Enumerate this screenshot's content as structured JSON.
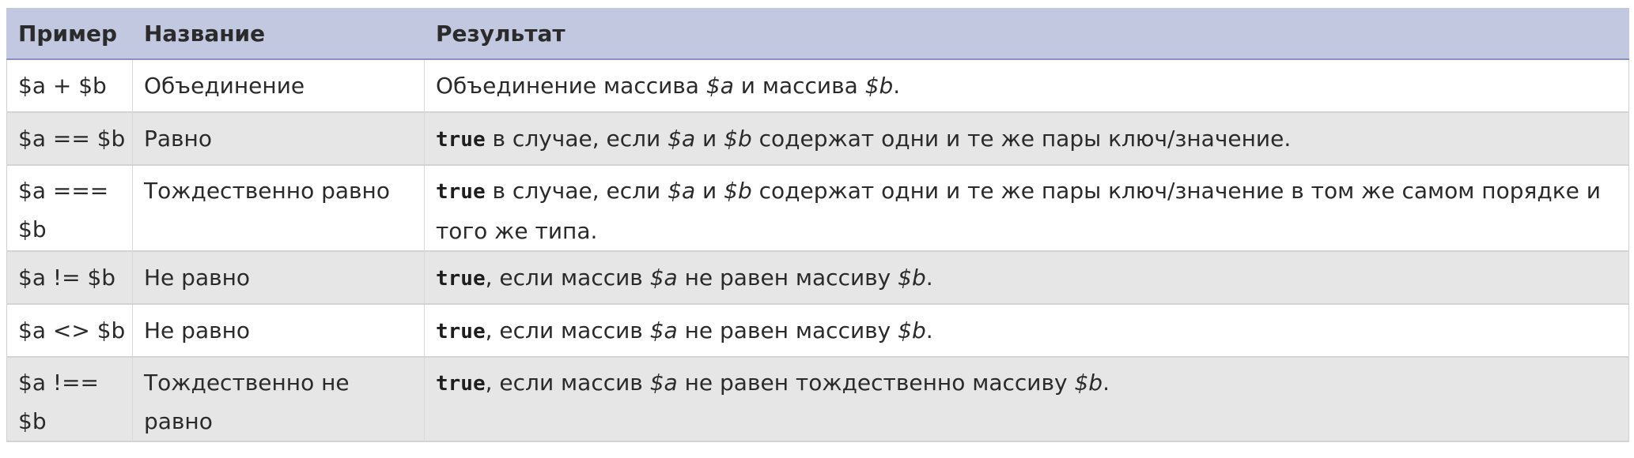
{
  "table": {
    "headers": [
      "Пример",
      "Название",
      "Результат"
    ],
    "rows": [
      {
        "example": "$a + $b",
        "name": "Объединение",
        "result_parts": [
          {
            "text": "Объединение массива ",
            "style": "plain"
          },
          {
            "text": "$a",
            "style": "var"
          },
          {
            "text": " и массива ",
            "style": "plain"
          },
          {
            "text": "$b",
            "style": "var"
          },
          {
            "text": ".",
            "style": "plain"
          }
        ]
      },
      {
        "example": "$a == $b",
        "name": "Равно",
        "result_parts": [
          {
            "text": "true",
            "style": "kw"
          },
          {
            "text": " в случае, если ",
            "style": "plain"
          },
          {
            "text": "$a",
            "style": "var"
          },
          {
            "text": " и ",
            "style": "plain"
          },
          {
            "text": "$b",
            "style": "var"
          },
          {
            "text": " содержат одни и те же пары ключ/значение.",
            "style": "plain"
          }
        ]
      },
      {
        "example": "$a === $b",
        "name": "Тождественно равно",
        "result_parts": [
          {
            "text": "true",
            "style": "kw"
          },
          {
            "text": " в случае, если ",
            "style": "plain"
          },
          {
            "text": "$a",
            "style": "var"
          },
          {
            "text": " и ",
            "style": "plain"
          },
          {
            "text": "$b",
            "style": "var"
          },
          {
            "text": " содержат одни и те же пары ключ/значение в том же самом порядке и того же типа.",
            "style": "plain"
          }
        ]
      },
      {
        "example": "$a != $b",
        "name": "Не равно",
        "result_parts": [
          {
            "text": "true",
            "style": "kw"
          },
          {
            "text": ", если массив ",
            "style": "plain"
          },
          {
            "text": "$a",
            "style": "var"
          },
          {
            "text": " не равен массиву ",
            "style": "plain"
          },
          {
            "text": "$b",
            "style": "var"
          },
          {
            "text": ".",
            "style": "plain"
          }
        ]
      },
      {
        "example": "$a <> $b",
        "name": "Не равно",
        "result_parts": [
          {
            "text": "true",
            "style": "kw"
          },
          {
            "text": ", если массив ",
            "style": "plain"
          },
          {
            "text": "$a",
            "style": "var"
          },
          {
            "text": " не равен массиву ",
            "style": "plain"
          },
          {
            "text": "$b",
            "style": "var"
          },
          {
            "text": ".",
            "style": "plain"
          }
        ]
      },
      {
        "example": "$a !== $b",
        "name": "Тождественно не равно",
        "result_parts": [
          {
            "text": "true",
            "style": "kw"
          },
          {
            "text": ", если массив ",
            "style": "plain"
          },
          {
            "text": "$a",
            "style": "var"
          },
          {
            "text": " не равен тождественно массиву ",
            "style": "plain"
          },
          {
            "text": "$b",
            "style": "var"
          },
          {
            "text": ".",
            "style": "plain"
          }
        ]
      }
    ]
  }
}
